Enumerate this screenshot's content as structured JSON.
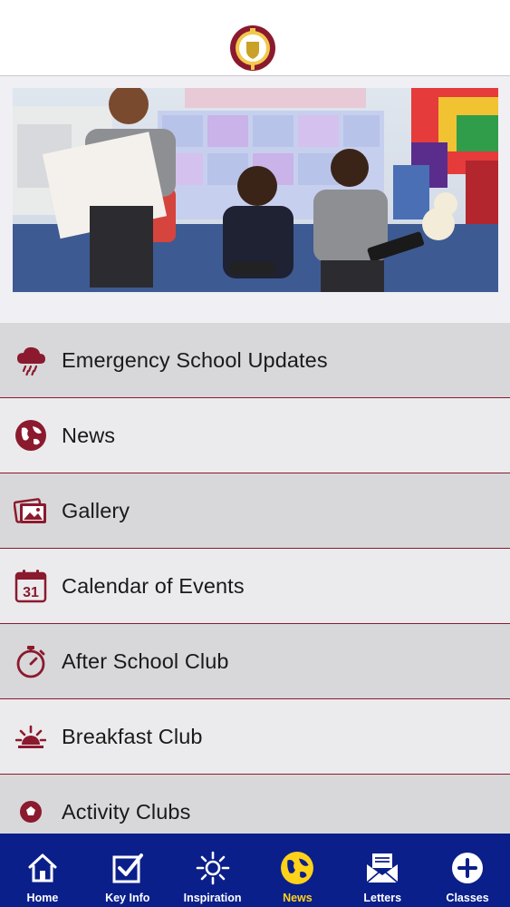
{
  "colors": {
    "accent": "#8b1a2e",
    "tabbar_bg": "#0b1f8a",
    "tab_active": "#ffd21a",
    "row_shade": "#d8d8da",
    "row_light": "#ebebed"
  },
  "header": {
    "logo_icon": "school-crest"
  },
  "hero": {
    "image": "children-reading-with-tablets"
  },
  "menu": {
    "items": [
      {
        "label": "Emergency School Updates",
        "icon": "storm-cloud-icon"
      },
      {
        "label": "News",
        "icon": "globe-icon"
      },
      {
        "label": "Gallery",
        "icon": "photos-icon"
      },
      {
        "label": "Calendar of Events",
        "icon": "calendar-icon",
        "icon_text": "31"
      },
      {
        "label": "After School Club",
        "icon": "stopwatch-icon"
      },
      {
        "label": "Breakfast Club",
        "icon": "sunrise-icon"
      },
      {
        "label": "Activity Clubs",
        "icon": "football-icon"
      }
    ]
  },
  "tabbar": {
    "active": "News",
    "tabs": [
      {
        "label": "Home",
        "icon": "home-icon"
      },
      {
        "label": "Key Info",
        "icon": "checkbox-icon"
      },
      {
        "label": "Inspiration",
        "icon": "sun-icon"
      },
      {
        "label": "News",
        "icon": "globe-icon"
      },
      {
        "label": "Letters",
        "icon": "envelope-icon"
      },
      {
        "label": "Classes",
        "icon": "plus-circle-icon"
      }
    ]
  }
}
